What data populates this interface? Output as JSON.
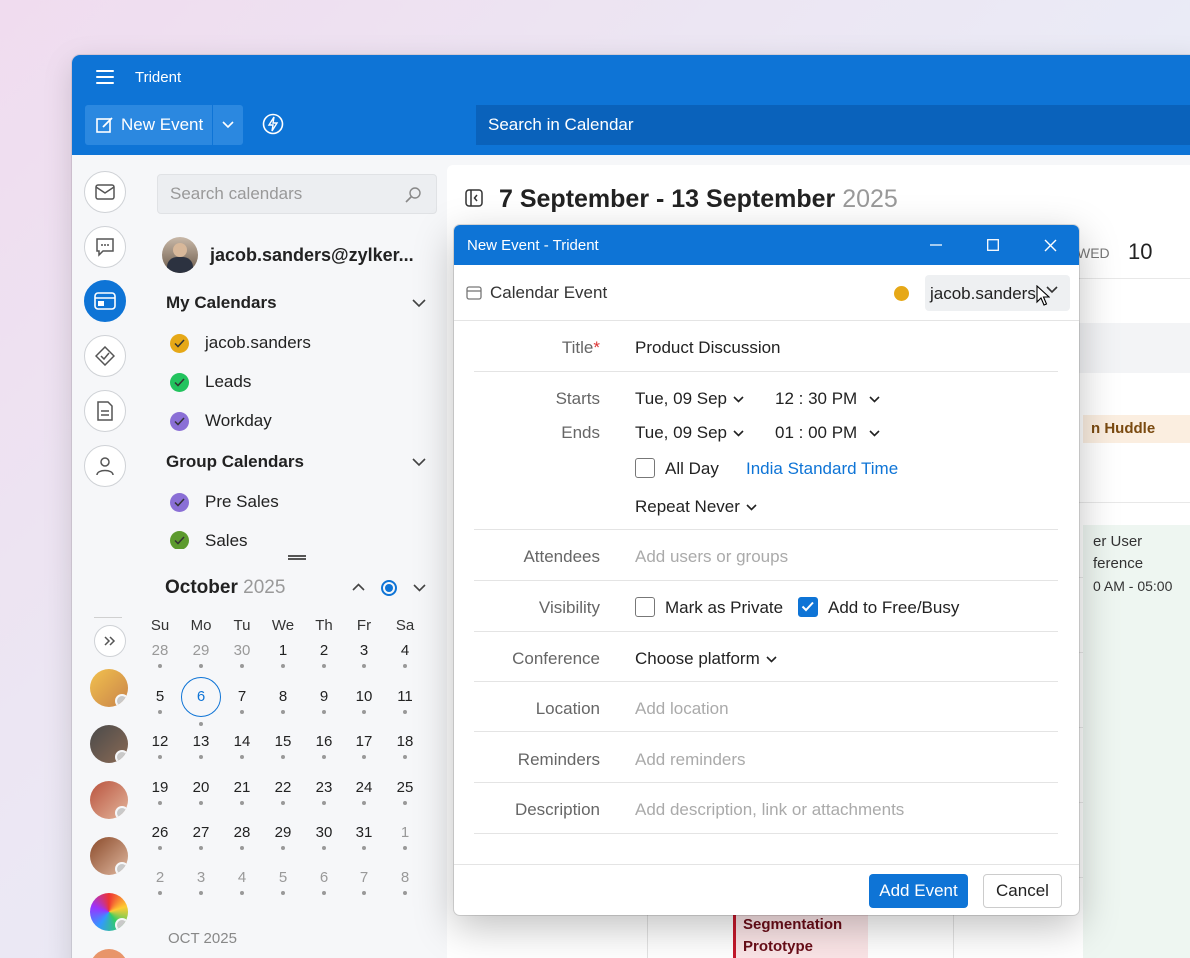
{
  "app": {
    "title": "Trident"
  },
  "toolbar": {
    "new_event_label": "New Event",
    "search_placeholder": "Search in Calendar"
  },
  "sidebar": {
    "search_placeholder": "Search calendars",
    "account_name": "jacob.sanders@zylker...",
    "my_calendars": {
      "title": "My Calendars",
      "items": [
        {
          "label": "jacob.sanders",
          "color": "#e6a817"
        },
        {
          "label": "Leads",
          "color": "#22c35e"
        },
        {
          "label": "Workday",
          "color": "#8a6fd6"
        }
      ]
    },
    "group_calendars": {
      "title": "Group Calendars",
      "items": [
        {
          "label": "Pre Sales",
          "color": "#8a6fd6"
        },
        {
          "label": "Sales",
          "color": "#5c9a2e"
        }
      ]
    }
  },
  "mini_calendar": {
    "month": "October",
    "year": "2025",
    "weekdays": [
      "Su",
      "Mo",
      "Tu",
      "We",
      "Th",
      "Fr",
      "Sa"
    ],
    "weeks": [
      [
        "28",
        "29",
        "30",
        "1",
        "2",
        "3",
        "4"
      ],
      [
        "5",
        "6",
        "7",
        "8",
        "9",
        "10",
        "11"
      ],
      [
        "12",
        "13",
        "14",
        "15",
        "16",
        "17",
        "18"
      ],
      [
        "19",
        "20",
        "21",
        "22",
        "23",
        "24",
        "25"
      ],
      [
        "26",
        "27",
        "28",
        "29",
        "30",
        "31",
        "1"
      ],
      [
        "2",
        "3",
        "4",
        "5",
        "6",
        "7",
        "8"
      ]
    ],
    "footer": "OCT 2025"
  },
  "main": {
    "week_range": "7 September - 13 September",
    "week_year": "2025",
    "day_label": "WED",
    "day_number": "10",
    "events": {
      "huddle": "n Huddle",
      "conf_line1": "er User",
      "conf_line2": "ference",
      "conf_time": "0 AM - 05:00",
      "seg_line1": "Segmentation",
      "seg_line2": "Prototype"
    }
  },
  "dialog": {
    "title": "New Event - Trident",
    "type": "Calendar Event",
    "owner": "jacob.sanders",
    "labels": {
      "title": "Title",
      "starts": "Starts",
      "ends": "Ends",
      "attendees": "Attendees",
      "visibility": "Visibility",
      "conference": "Conference",
      "location": "Location",
      "reminders": "Reminders",
      "description": "Description"
    },
    "values": {
      "title": "Product Discussion",
      "start_date": "Tue, 09 Sep",
      "start_time": "12 : 30 PM",
      "end_date": "Tue, 09 Sep",
      "end_time": "01 : 00 PM",
      "all_day": "All Day",
      "timezone": "India Standard Time",
      "repeat": "Repeat Never",
      "attendees_placeholder": "Add users or groups",
      "private_label": "Mark as Private",
      "freebusy_label": "Add to Free/Busy",
      "conference": "Choose platform",
      "location_placeholder": "Add location",
      "reminders_placeholder": "Add reminders",
      "description_placeholder": "Add description, link or attachments"
    },
    "add_button": "Add Event",
    "cancel_button": "Cancel"
  }
}
